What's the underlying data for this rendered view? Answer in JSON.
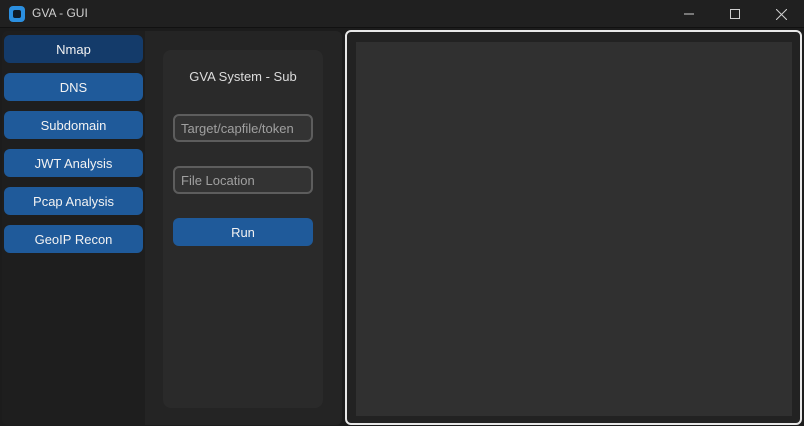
{
  "window": {
    "title": "GVA - GUI",
    "icon": "app-icon",
    "controls": [
      "minimize-icon",
      "maximize-icon",
      "close-icon"
    ]
  },
  "sidebar": {
    "items": [
      {
        "label": "Nmap",
        "active": true
      },
      {
        "label": "DNS",
        "active": false
      },
      {
        "label": "Subdomain",
        "active": false
      },
      {
        "label": "JWT Analysis",
        "active": false
      },
      {
        "label": "Pcap Analysis",
        "active": false
      },
      {
        "label": "GeoIP Recon",
        "active": false
      }
    ]
  },
  "subpanel": {
    "title": "GVA System - Sub",
    "target_placeholder": "Target/capfile/token",
    "target_value": "",
    "file_placeholder": "File Location",
    "file_value": "",
    "run_label": "Run"
  },
  "output": {
    "text": ""
  },
  "colors": {
    "accent": "#1f5a9a",
    "accent_active": "#143b6a",
    "background": "#1c1c1c",
    "panel": "#242424",
    "output_bg": "#303030"
  }
}
